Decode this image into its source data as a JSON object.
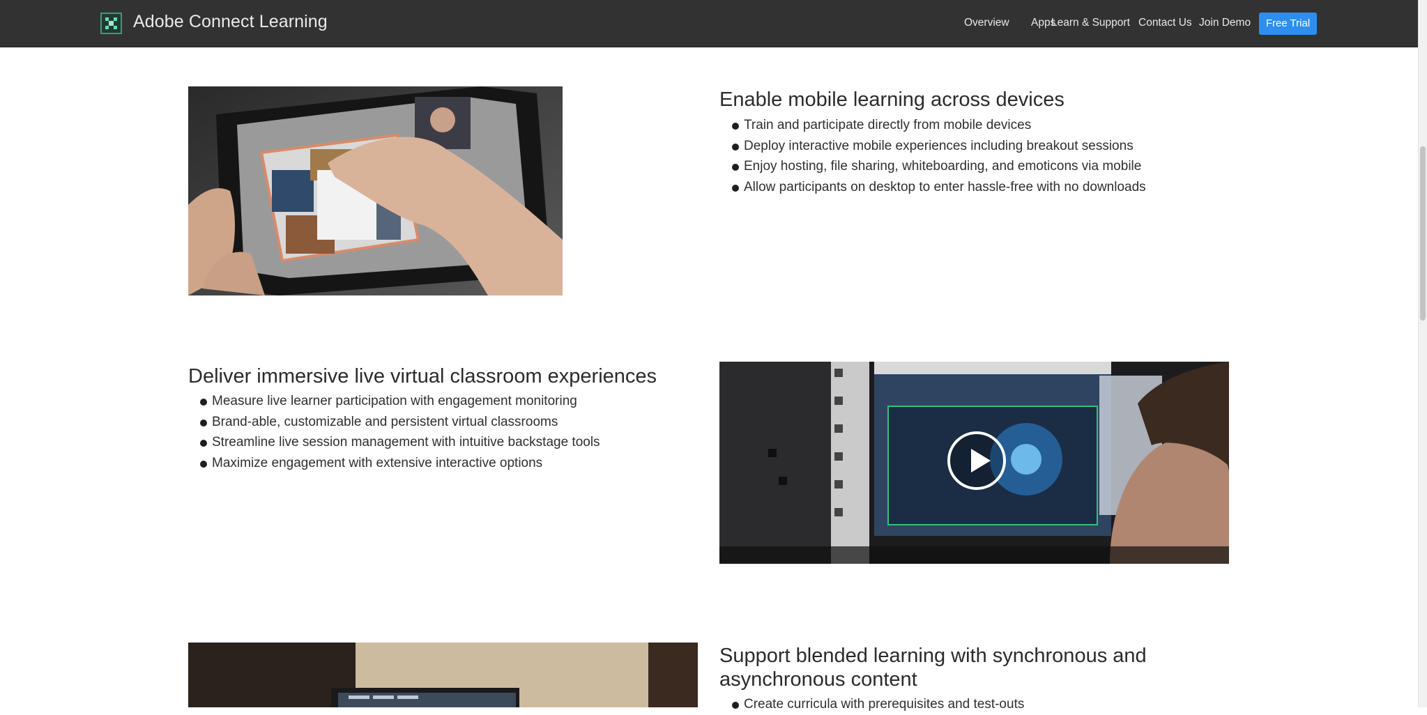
{
  "header": {
    "brand": "Adobe Connect Learning",
    "logo_icon": "adobe-connect-logo-icon",
    "nav": [
      {
        "label": "Overview"
      },
      {
        "label": "Apps"
      },
      {
        "label": "Learn & Support"
      },
      {
        "label": "Contact Us"
      },
      {
        "label": "Join Demo"
      }
    ],
    "cta_label": "Free Trial",
    "cta_color": "#2d8ef0",
    "bar_color": "#323232"
  },
  "sections": [
    {
      "title": "Enable mobile learning across devices",
      "bullets": [
        "Train and participate directly from mobile devices",
        "Deploy interactive mobile experiences including breakout sessions",
        "Enjoy hosting, file sharing, whiteboarding, and emoticons via mobile",
        "Allow participants on desktop to enter hassle-free with no downloads"
      ]
    },
    {
      "title": "Deliver immersive live virtual classroom experiences",
      "bullets": [
        "Measure live learner participation with engagement monitoring",
        "Brand-able, customizable and persistent virtual classrooms",
        "Streamline live session management with intuitive backstage tools",
        "Maximize engagement with extensive interactive options"
      ]
    },
    {
      "title": "Support blended learning with synchronous and asynchronous content",
      "bullets": [
        "Create curricula with prerequisites and test-outs"
      ]
    }
  ],
  "media": {
    "video_play_icon": "play-icon"
  }
}
